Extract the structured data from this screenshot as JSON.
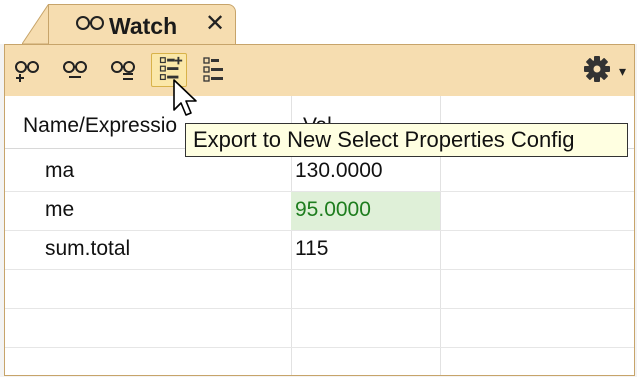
{
  "tab": {
    "title": "Watch",
    "close_glyph": "✕",
    "icon": "glasses-icon"
  },
  "toolbar": {
    "buttons": [
      {
        "icon": "add-watch-icon"
      },
      {
        "icon": "remove-watch-icon"
      },
      {
        "icon": "remove-all-watch-icon"
      },
      {
        "icon": "export-properties-config-icon",
        "hovered": true
      },
      {
        "icon": "properties-config-icon"
      }
    ],
    "menu_icon": "gear-icon",
    "menu_arrow_glyph": "▾"
  },
  "tooltip": {
    "text": "Export to New Select Properties Config"
  },
  "table": {
    "columns": [
      "Name/Expressio",
      "Val"
    ],
    "rows": [
      {
        "name": "ma",
        "value": "130.0000",
        "changed": false
      },
      {
        "name": "me",
        "value": "95.0000",
        "changed": true
      },
      {
        "name": "sum.total",
        "value": "115",
        "changed": false
      },
      {
        "name": "",
        "value": ""
      },
      {
        "name": "",
        "value": ""
      },
      {
        "name": "",
        "value": ""
      }
    ]
  },
  "colors": {
    "tab_bg": "#f6ddb0",
    "changed_value_bg": "#dff0d8",
    "changed_value_text": "#1e7d1e",
    "tooltip_bg": "#ffffe1"
  }
}
